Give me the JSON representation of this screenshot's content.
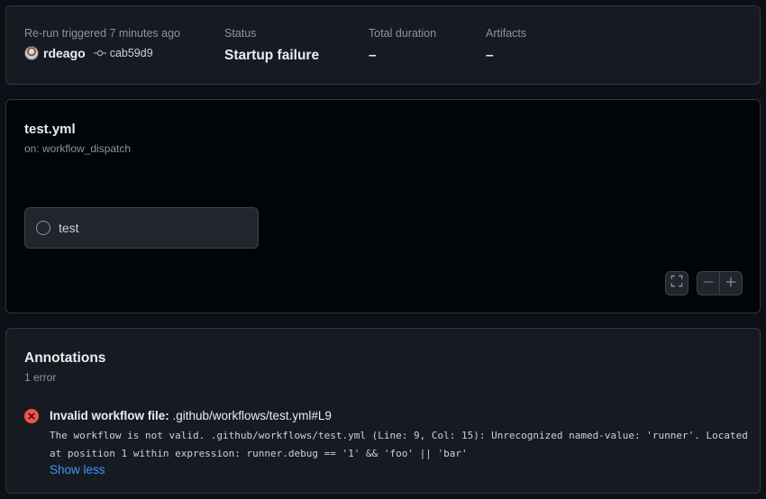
{
  "summary": {
    "trigger_label": "Re-run triggered 7 minutes ago",
    "user": "rdeago",
    "commit_sha": "cab59d9",
    "status_label": "Status",
    "status_value": "Startup failure",
    "duration_label": "Total duration",
    "duration_value": "–",
    "artifacts_label": "Artifacts",
    "artifacts_value": "–"
  },
  "workflow": {
    "file": "test.yml",
    "trigger": "on: workflow_dispatch",
    "jobs": [
      {
        "name": "test",
        "status": "pending"
      }
    ],
    "controls": {
      "fullscreen_icon": "fullscreen-icon",
      "zoom_out_icon": "minus-icon",
      "zoom_in_icon": "plus-icon"
    }
  },
  "annotations": {
    "title": "Annotations",
    "count": "1 error",
    "items": [
      {
        "severity_icon": "x-circle-icon",
        "title_prefix": "Invalid workflow file:",
        "title_path": " .github/workflows/test.yml#L9",
        "message": "The workflow is not valid. .github/workflows/test.yml (Line: 9, Col: 15): Unrecognized named-value: 'runner'. Located at position 1 within expression: runner.debug == '1' && 'foo' || 'bar'",
        "toggle": "Show less"
      }
    ]
  },
  "colors": {
    "background": "#0d1117",
    "card": "#161b22",
    "border": "#30363d",
    "error": "#f85149",
    "link": "#4493f8"
  }
}
